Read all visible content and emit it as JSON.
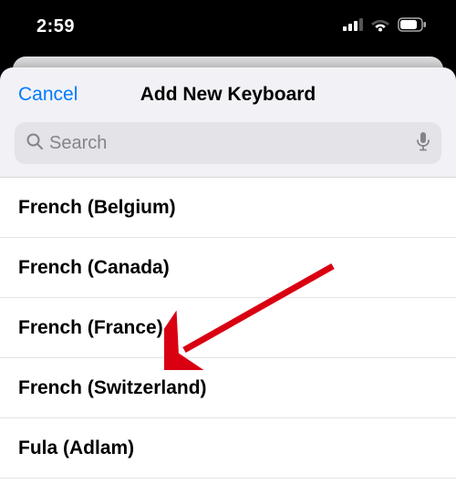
{
  "status": {
    "time": "2:59"
  },
  "nav": {
    "cancel": "Cancel",
    "title": "Add New Keyboard"
  },
  "search": {
    "placeholder": "Search",
    "value": ""
  },
  "list": {
    "items": [
      "French (Belgium)",
      "French (Canada)",
      "French (France)",
      "French (Switzerland)",
      "Fula (Adlam)"
    ]
  },
  "colors": {
    "accent": "#007aff"
  }
}
